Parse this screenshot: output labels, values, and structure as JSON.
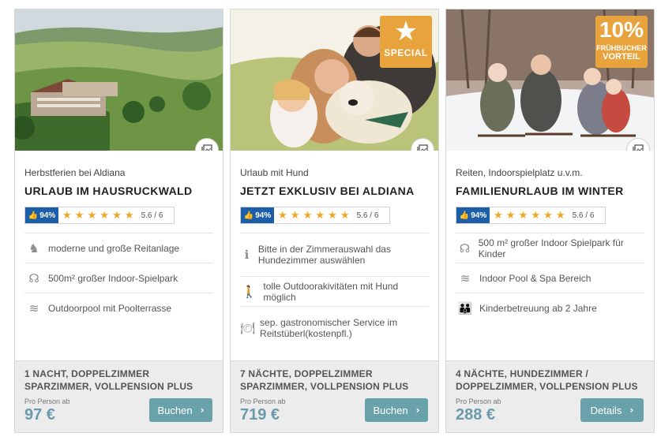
{
  "cards": [
    {
      "subtitle": "Herbstferien bei Aldiana",
      "title": "URLAUB IM HAUSRUCKWALD",
      "rating": {
        "percent": "94%",
        "stars": "★ ★ ★ ★ ★ ★",
        "score": "5.6 / 6"
      },
      "features": [
        {
          "icon": "horse-riding-icon",
          "glyph": "♞",
          "text": "moderne und große Reitanlage"
        },
        {
          "icon": "playground-icon",
          "glyph": "☊",
          "text": "500m² großer Indoor-Spielpark"
        },
        {
          "icon": "pool-icon",
          "glyph": "≋",
          "text": "Outdoorpool mit Poolterrasse"
        }
      ],
      "room": "1 NACHT, DOPPELZIMMER SPARZIMMER, VOLLPENSION PLUS",
      "per_person": "Pro Person ab",
      "price": "97 €",
      "button": "Buchen"
    },
    {
      "subtitle": "Urlaub mit Hund",
      "title": "JETZT EXKLUSIV BEI ALDIANA",
      "badge": {
        "glyph": "★",
        "text": "SPECIAL"
      },
      "rating": {
        "percent": "94%",
        "stars": "★ ★ ★ ★ ★ ★",
        "score": "5.6 / 6"
      },
      "features": [
        {
          "icon": "info-icon",
          "glyph": "ℹ",
          "text": "Bitte in der Zimmerauswahl das Hundezimmer auswählen"
        },
        {
          "icon": "hiking-icon",
          "glyph": "🚶",
          "text": "tolle Outdoorakivitäten mit Hund möglich"
        },
        {
          "icon": "dining-icon",
          "glyph": "🍽",
          "text": "sep. gastronomischer Service im Reitstüberl(kostenpfl.)"
        }
      ],
      "room": "7 NÄCHTE, DOPPELZIMMER SPARZIMMER, VOLLPENSION PLUS",
      "per_person": "Pro Person ab",
      "price": "719 €",
      "button": "Buchen"
    },
    {
      "subtitle": "Reiten, Indoorspielplatz u.v.m.",
      "title": "FAMILIENURLAUB IM WINTER",
      "badge": {
        "pct": "10%",
        "line1": "FRÜHBUCHER",
        "line2": "VORTEIL"
      },
      "rating": {
        "percent": "94%",
        "stars": "★ ★ ★ ★ ★ ★",
        "score": "5.6 / 6"
      },
      "features": [
        {
          "icon": "playground-icon",
          "glyph": "☊",
          "text": "500 m² großer Indoor Spielpark für Kinder"
        },
        {
          "icon": "pool-icon",
          "glyph": "≋",
          "text": "Indoor Pool & Spa Bereich"
        },
        {
          "icon": "childcare-icon",
          "glyph": "👪",
          "text": "Kinderbetreuung ab 2 Jahre"
        }
      ],
      "room": "4 NÄCHTE, HUNDEZIMMER / DOPPELZIMMER, VOLLPENSION PLUS",
      "per_person": "Pro Person ab",
      "price": "288 €",
      "button": "Details"
    }
  ],
  "colors": {
    "accent": "#6aa2ab",
    "price": "#6a9aab",
    "rating_blue": "#1d5ea8",
    "star": "#f2a521",
    "badge": "#e8a33d"
  }
}
